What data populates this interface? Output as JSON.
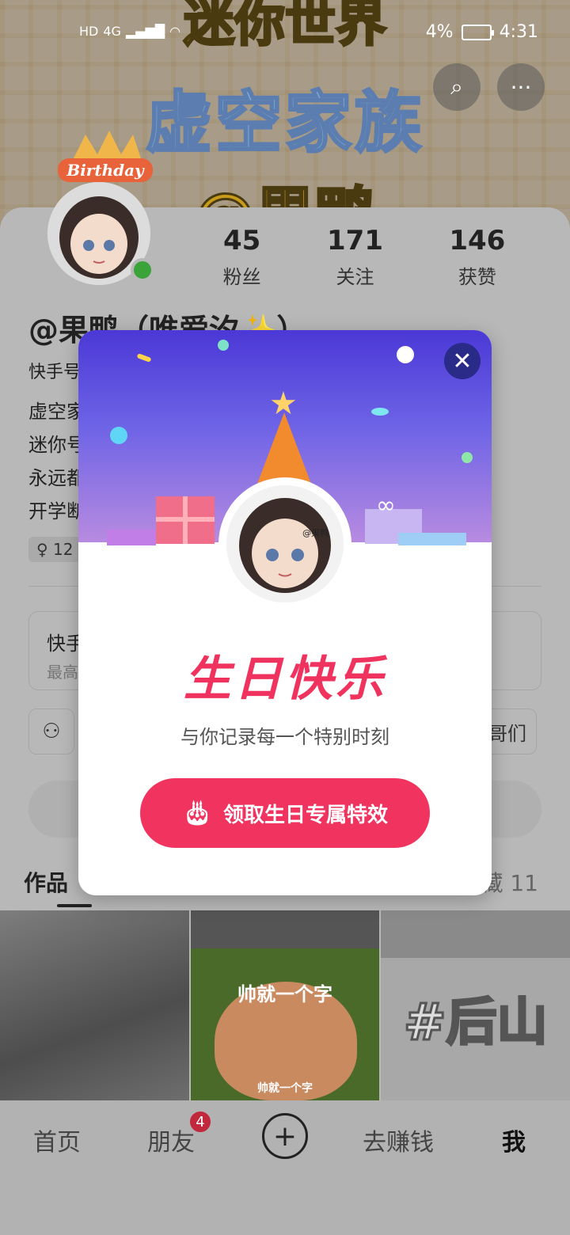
{
  "status_bar": {
    "network_left": "HD",
    "network_gen": "4G",
    "battery_percent": "4%",
    "time": "4:31"
  },
  "banner": {
    "line1": "迷你世界",
    "line2": "虚空家族",
    "line3": "@果鸭"
  },
  "profile": {
    "stats": [
      {
        "num": "45",
        "label": "粉丝"
      },
      {
        "num": "171",
        "label": "关注"
      },
      {
        "num": "146",
        "label": "获赞"
      }
    ],
    "name": "@果鸭（唯爱汐✨）",
    "kwai_id_prefix": "快手号",
    "bio_lines": [
      "虚空家",
      "迷你号",
      "永远都",
      "开学断"
    ],
    "tag_chip": "♀ 12",
    "info_card_title": "快手",
    "info_card_sub": "最高",
    "group_button": "哥们"
  },
  "tabs": {
    "works": "作品",
    "fav": "藏 11"
  },
  "grid": {
    "cell2_caption": "帅就一个字",
    "cell2_subcaption": "帅就一个字",
    "cell3_caption": "#后山"
  },
  "nav": {
    "home": "首页",
    "friends": "朋友",
    "friends_badge": "4",
    "earn": "去赚钱",
    "me": "我"
  },
  "modal": {
    "title": "生日快乐",
    "subtitle": "与你记录每一个特别时刻",
    "button": "领取生日专属特效",
    "watermark": "@果鸭"
  },
  "colors": {
    "accent": "#f0345f",
    "modal_gradient_top": "#4b38d6",
    "online": "#3aa33a"
  }
}
